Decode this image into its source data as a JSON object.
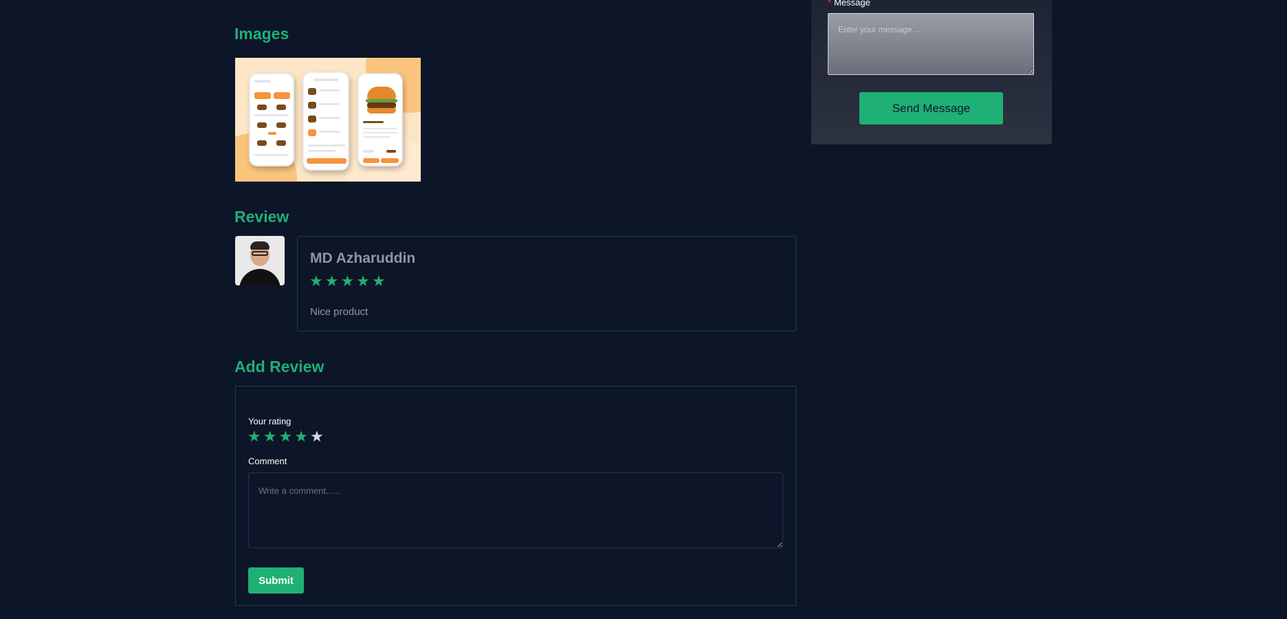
{
  "sections": {
    "images_title": "Images",
    "review_title": "Review",
    "add_review_title": "Add Review"
  },
  "review": {
    "reviewer_name": "MD Azharuddin",
    "rating": 5,
    "max_rating": 5,
    "text": "Nice product"
  },
  "add_review": {
    "rating_label": "Your rating",
    "selected_rating": 4,
    "max_rating": 5,
    "comment_label": "Comment",
    "comment_placeholder": "Write a comment......",
    "submit_label": "Submit"
  },
  "contact": {
    "message_required_mark": "*",
    "message_label": "Message",
    "message_placeholder": "Enter your message ...",
    "send_label": "Send Message"
  },
  "colors": {
    "accent": "#1fb075",
    "background": "#0d1528",
    "required": "#e23b3b"
  }
}
